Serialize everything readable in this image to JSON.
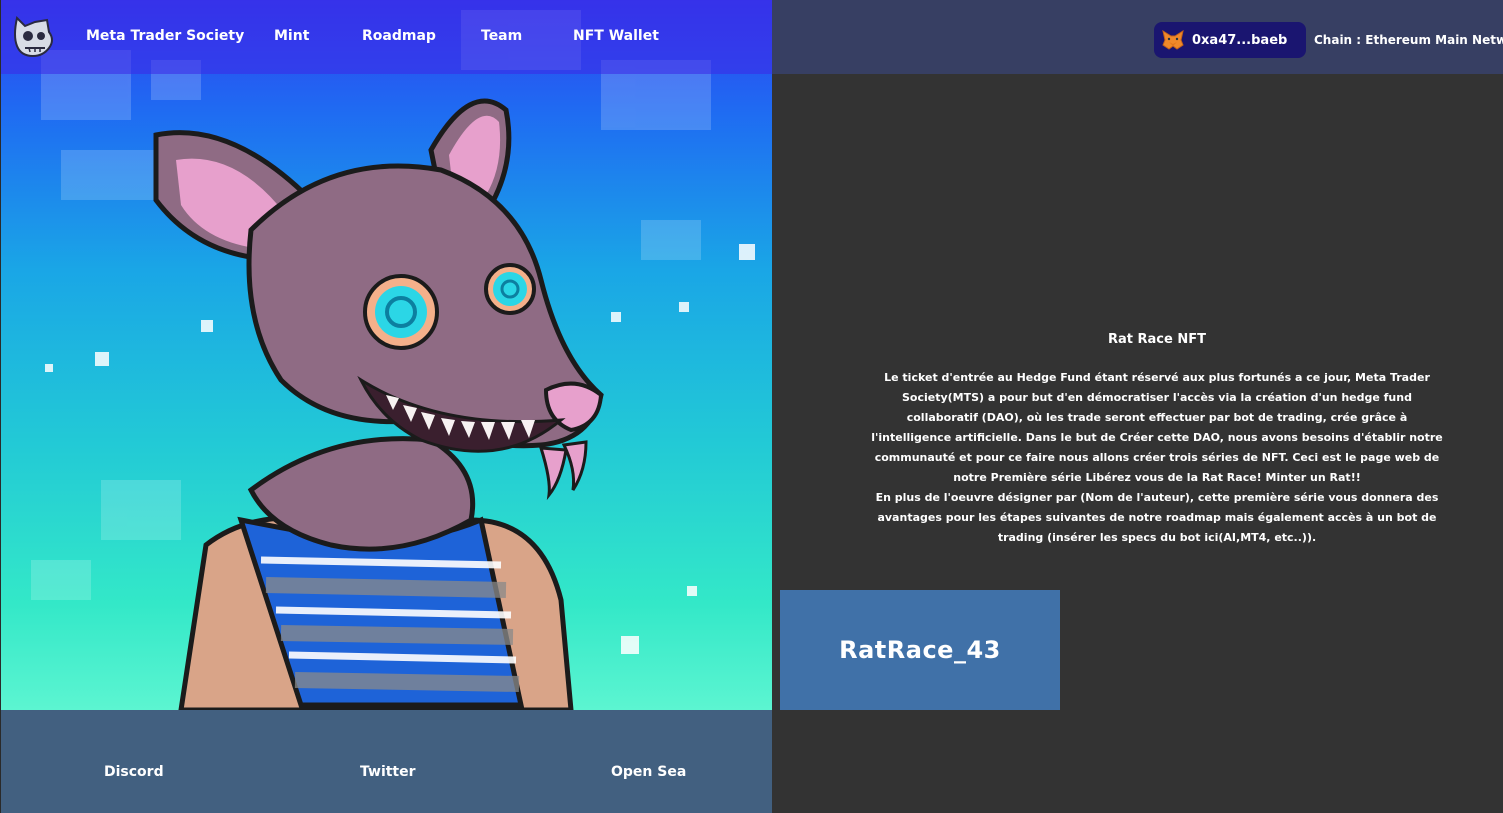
{
  "nav": {
    "brand": "Meta Trader Society",
    "items": [
      "Mint",
      "Roadmap",
      "Team",
      "NFT Wallet"
    ]
  },
  "wallet": {
    "address": "0xa47...baeb",
    "chain_label": "Chain : Ethereum Main Network"
  },
  "content": {
    "title": "Rat Race NFT",
    "paragraph_1": "Le ticket d'entrée au Hedge Fund étant réservé aux plus fortunés a ce jour, Meta Trader Society(MTS) a pour but d'en démocratiser l'accès via la création d'un hedge fund collaboratif (DAO), où les trade seront effectuer par bot de trading, crée grâce à l'intelligence artificielle. Dans le but de Créer cette DAO, nous avons besoins d'établir notre communauté et pour ce faire nous allons créer trois séries de NFT. Ceci est le page web de notre Première série Libérez vous de la Rat Race! Minter un Rat!!",
    "paragraph_2": "En plus de l'oeuvre désigner par (Nom de l'auteur), cette première série vous donnera des avantages pour les étapes suivantes de notre roadmap mais également accès à un bot de trading (insérer les specs du bot ici(AI,MT4, etc..))."
  },
  "nft": {
    "name": "RatRace_43"
  },
  "footer": {
    "links": [
      "Discord",
      "Twitter",
      "Open Sea"
    ]
  },
  "colors": {
    "nav_overlay": "#3c28e6",
    "right_header": "#373f63",
    "content_bg": "#333333",
    "footer_bg": "#426080",
    "wallet_btn": "#1a1570",
    "nft_card": "#4071a8"
  },
  "icons": {
    "logo": "rat-skull-logo-icon",
    "wallet": "metamask-fox-icon"
  }
}
